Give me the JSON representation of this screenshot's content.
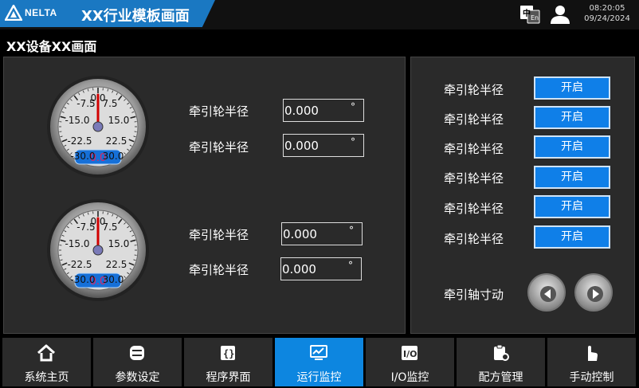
{
  "header": {
    "logo_text": "NELTA",
    "app_title": "XX行业模板画面",
    "time": "08:20:05",
    "date": "09/24/2024"
  },
  "page_title": "XX设备XX画面",
  "gauges": [
    {
      "scale_labels": [
        "0.0",
        "-7.5",
        "7.5",
        "-15.0",
        "15.0",
        "-22.5",
        "22.5",
        "-30.0",
        "30.0"
      ],
      "readout": "0.0",
      "value": 0.0
    },
    {
      "scale_labels": [
        "0.0",
        "-7.5",
        "7.5",
        "-15.0",
        "15.0",
        "-22.5",
        "22.5",
        "-30.0",
        "30.0"
      ],
      "readout": "0.0",
      "value": 0.0
    }
  ],
  "left_fields": [
    {
      "label": "牵引轮半径",
      "value": "0.000",
      "unit": "°"
    },
    {
      "label": "牵引轮半径",
      "value": "0.000",
      "unit": "°"
    },
    {
      "label": "牵引轮半径",
      "value": "0.000",
      "unit": "°"
    },
    {
      "label": "牵引轮半径",
      "value": "0.000",
      "unit": "°"
    }
  ],
  "right_rows": [
    {
      "label": "牵引轮半径",
      "button": "开启"
    },
    {
      "label": "牵引轮半径",
      "button": "开启"
    },
    {
      "label": "牵引轮半径",
      "button": "开启"
    },
    {
      "label": "牵引轮半径",
      "button": "开启"
    },
    {
      "label": "牵引轮半径",
      "button": "开启"
    },
    {
      "label": "牵引轮半径",
      "button": "开启"
    }
  ],
  "jog_label": "牵引轴寸动",
  "nav": [
    {
      "label": "系统主页",
      "icon": "home-icon",
      "active": false
    },
    {
      "label": "参数设定",
      "icon": "parameter-icon",
      "active": false
    },
    {
      "label": "程序界面",
      "icon": "program-icon",
      "active": false
    },
    {
      "label": "运行监控",
      "icon": "monitor-icon",
      "active": true
    },
    {
      "label": "I/O监控",
      "icon": "io-icon",
      "active": false
    },
    {
      "label": "配方管理",
      "icon": "recipe-icon",
      "active": false
    },
    {
      "label": "手动控制",
      "icon": "hand-icon",
      "active": false
    }
  ],
  "colors": {
    "brand_blue": "#1a78c2",
    "button_blue": "#0f7fe8",
    "nav_active": "#0d86e0",
    "panel": "#2a2a2a"
  }
}
